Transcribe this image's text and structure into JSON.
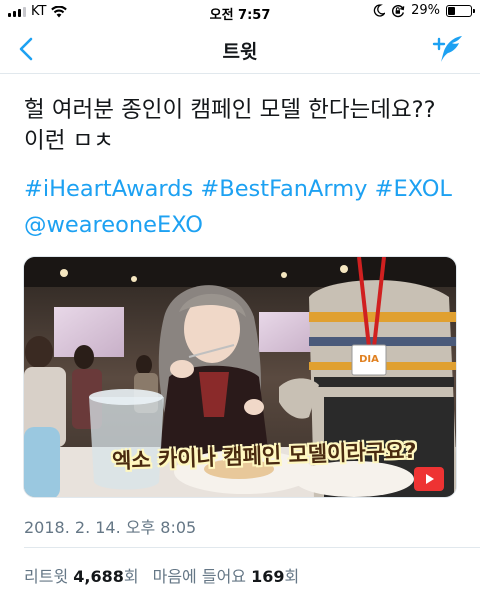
{
  "status_bar": {
    "carrier": "KT",
    "time": "오전 7:57",
    "battery_percent": "29%",
    "battery_level": 0.29,
    "icons": [
      "signal-icon",
      "wifi-icon",
      "moon-icon",
      "orientation-lock-icon",
      "battery-icon"
    ]
  },
  "nav": {
    "title": "트윗",
    "back_icon": "chevron-left-icon",
    "compose_icon": "compose-tweet-icon"
  },
  "colors": {
    "accent": "#1da1f2",
    "text": "#14171a",
    "muted": "#657786",
    "divider": "#e1e8ed"
  },
  "tweet": {
    "text_line1": "헐 여러분 종인이 캠페인 모델 한다는데요??",
    "text_line2": "이런 ㅁㅊ",
    "hashtag1": "#iHeartAwards",
    "hashtag2": "#BestFanArmy",
    "hashtag3": "#EXOL",
    "mention": "@weareoneEXO",
    "media_caption": "엑소 카이나 캠페인 모델이라구요?",
    "badge_text": "DIA",
    "timestamp": "2018. 2. 14. 오후 8:05"
  },
  "stats": {
    "retweets_label": "리트윗",
    "retweets_count": "4,688",
    "retweets_unit": "회",
    "likes_label": "마음에 들어요",
    "likes_count": "169",
    "likes_unit": "회"
  }
}
